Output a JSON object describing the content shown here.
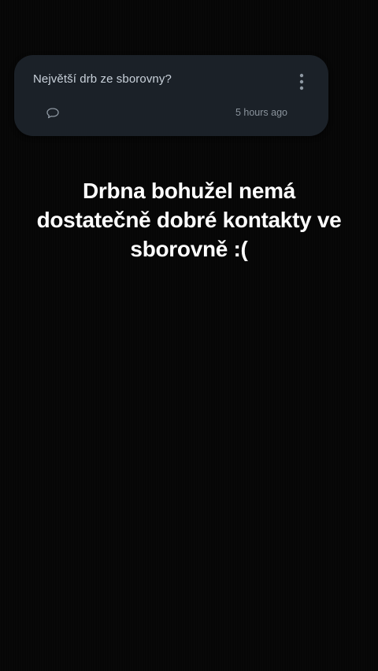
{
  "post": {
    "question": "Největší drb ze sborovny?",
    "timestamp": "5 hours ago",
    "icons": {
      "comment": "comment-bubble-icon",
      "more": "more-vertical-icon"
    }
  },
  "message": {
    "lines": [
      "Drbna bohužel nemá",
      "dostatečně dobré kontakty ve",
      "sborovně :("
    ]
  },
  "colors": {
    "background": "#060606",
    "card": "#1b2128",
    "question_text": "#c9d1da",
    "muted_text": "#8a939c",
    "message_text": "#ffffff"
  }
}
